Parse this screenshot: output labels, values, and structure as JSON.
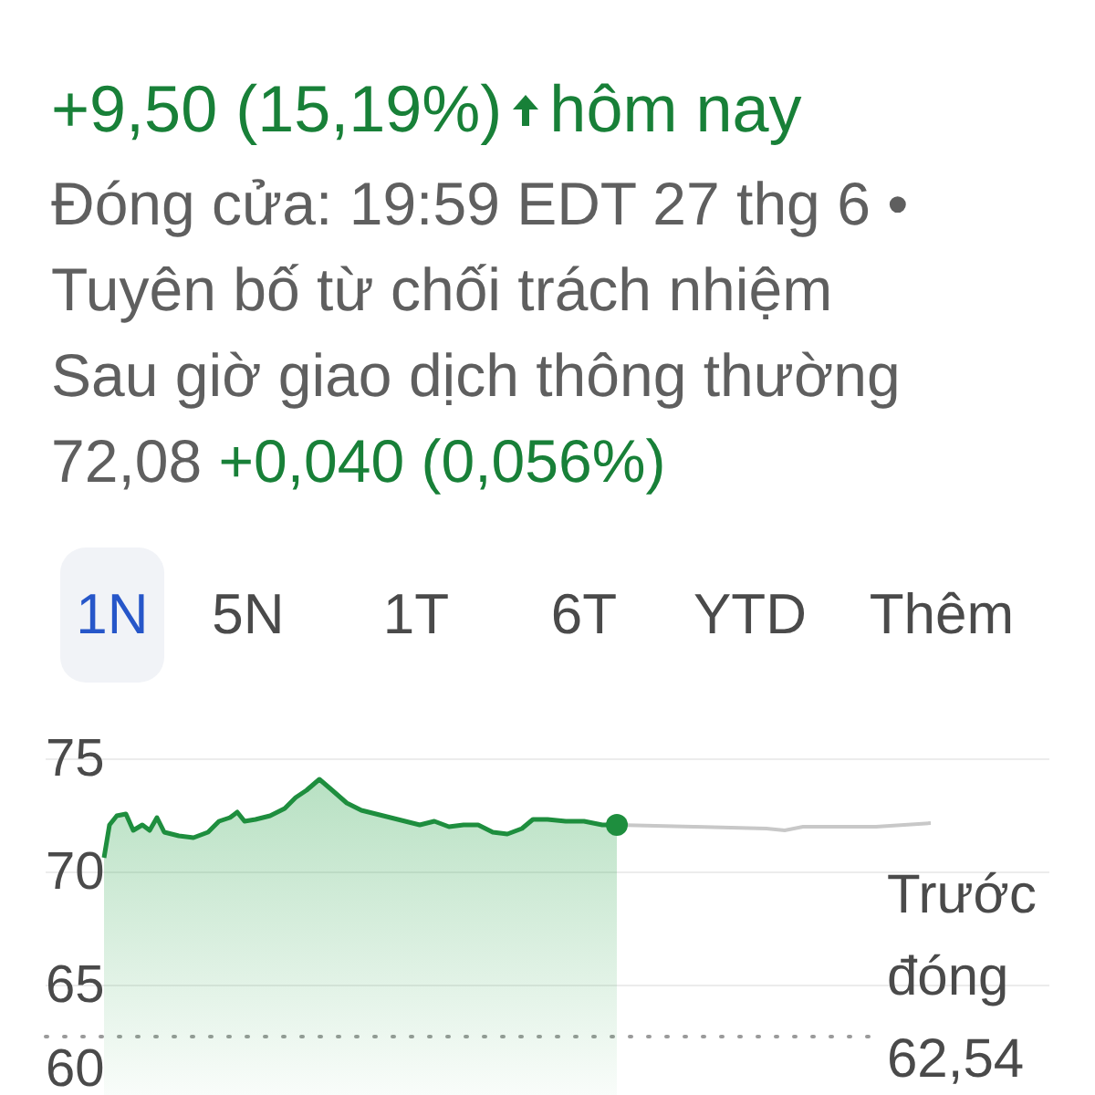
{
  "change": {
    "value": "+9,50 (15,19%)",
    "period": "hôm nay"
  },
  "close_info": "Đóng cửa: 19:59 EDT 27 thg 6 • Tuyên bố từ chối trách nhiệm",
  "after_hours": {
    "label": "Sau giờ giao dịch thông thường 72,08",
    "change": "+0,040 (0,056%)"
  },
  "tabs": [
    {
      "label": "1N",
      "selected": true
    },
    {
      "label": "5N",
      "selected": false
    },
    {
      "label": "1T",
      "selected": false
    },
    {
      "label": "6T",
      "selected": false
    },
    {
      "label": "YTD",
      "selected": false
    },
    {
      "label": "Thêm",
      "selected": false
    }
  ],
  "chart": {
    "y_labels": [
      "75",
      "70",
      "65",
      "60"
    ],
    "previous_close": {
      "label": "Trước đóng",
      "value": "62,54"
    }
  }
}
